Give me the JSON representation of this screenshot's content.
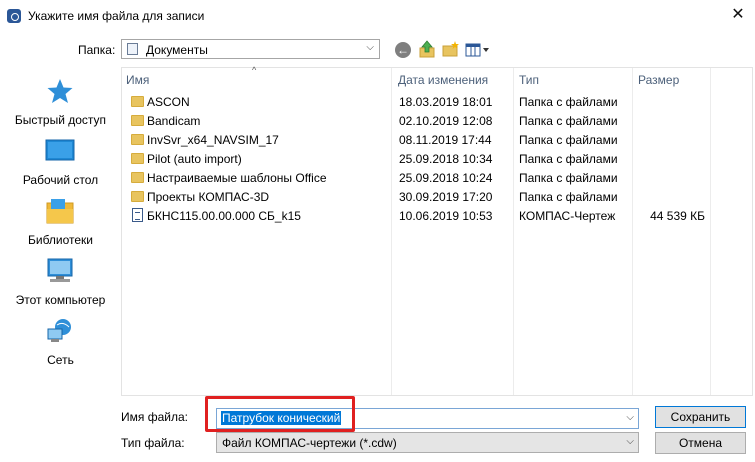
{
  "window": {
    "title": "Укажите имя файла для записи",
    "close_glyph": "✕"
  },
  "toolbar": {
    "folder_label": "Папка:",
    "folder_value": "Документы",
    "dropdown_glyph": "⌵",
    "back_glyph": "←"
  },
  "places": [
    {
      "label": "Быстрый доступ",
      "icon": "star-icon"
    },
    {
      "label": "Рабочий стол",
      "icon": "desktop-icon"
    },
    {
      "label": "Библиотеки",
      "icon": "libraries-icon"
    },
    {
      "label": "Этот компьютер",
      "icon": "computer-icon"
    },
    {
      "label": "Сеть",
      "icon": "network-icon"
    }
  ],
  "columns": {
    "name": "Имя",
    "date": "Дата изменения",
    "type": "Тип",
    "size": "Размер",
    "sort_glyph": "^"
  },
  "files": [
    {
      "name": "ASCON",
      "date": "18.03.2019 18:01",
      "type": "Папка с файлами",
      "size": "",
      "icon": "folder-icon"
    },
    {
      "name": "Bandicam",
      "date": "02.10.2019 12:08",
      "type": "Папка с файлами",
      "size": "",
      "icon": "folder-icon"
    },
    {
      "name": "InvSvr_x64_NAVSIM_17",
      "date": "08.11.2019 17:44",
      "type": "Папка с файлами",
      "size": "",
      "icon": "folder-icon"
    },
    {
      "name": "Pilot (auto import)",
      "date": "25.09.2018 10:34",
      "type": "Папка с файлами",
      "size": "",
      "icon": "folder-icon"
    },
    {
      "name": "Настраиваемые шаблоны Office",
      "date": "25.09.2018 10:24",
      "type": "Папка с файлами",
      "size": "",
      "icon": "folder-icon"
    },
    {
      "name": "Проекты КОМПАС-3D",
      "date": "30.09.2019 17:20",
      "type": "Папка с файлами",
      "size": "",
      "icon": "folder-icon"
    },
    {
      "name": "БКНС115.00.00.000 СБ_k15",
      "date": "10.06.2019 10:53",
      "type": "КОМПАС-Чертеж",
      "size": "44 539 КБ",
      "icon": "document-icon"
    }
  ],
  "bottom": {
    "filename_label": "Имя файла:",
    "filename_value": "Патрубок конический",
    "filetype_label": "Тип файла:",
    "filetype_value": "Файл КОМПАС-чертежи (*.cdw)",
    "save_label": "Сохранить",
    "cancel_label": "Отмена"
  },
  "colors": {
    "accent": "#0078d7",
    "highlight": "#e02020",
    "folder": "#e8c45f"
  }
}
